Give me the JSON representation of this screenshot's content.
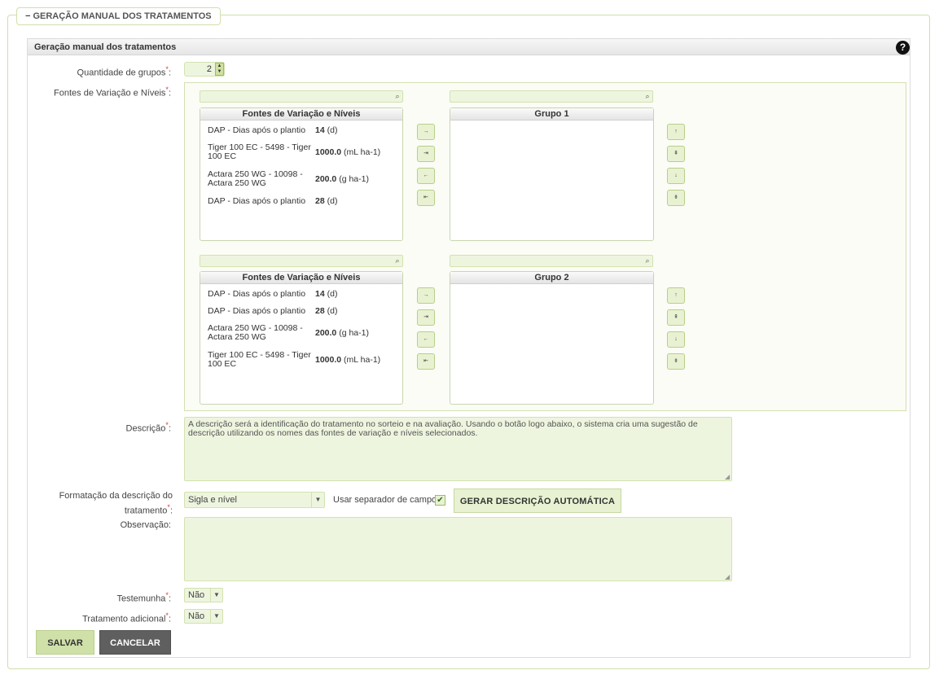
{
  "fieldset": {
    "toggle": "−",
    "legend": "GERAÇÃO MANUAL DOS TRATAMENTOS"
  },
  "panel": {
    "title": "Geração manual dos tratamentos",
    "help": "?"
  },
  "labels": {
    "quantidade": "Quantidade de grupos",
    "fontes": "Fontes de Variação e Níveis",
    "descricao": "Descrição",
    "formatacao_line1": "Formatação da descrição do",
    "formatacao_line2": "tratamento",
    "observacao": "Observação:",
    "testemunha": "Testemunha",
    "tratamento_adicional": "Tratamento adicional",
    "required_mark": "*",
    "colon": ":"
  },
  "quantidade_grupos": "2",
  "groups": [
    {
      "source_header": "Fontes de Variação e Níveis",
      "target_header": "Grupo 1",
      "items": [
        {
          "name": "DAP - Dias após o plantio",
          "value": "14",
          "unit": "(d)"
        },
        {
          "name": "Tiger 100 EC - 5498 - Tiger 100 EC",
          "value": "1000.0",
          "unit": "(mL ha-1)"
        },
        {
          "name": "Actara 250 WG - 10098 - Actara 250 WG",
          "value": "200.0",
          "unit": "(g ha-1)"
        },
        {
          "name": "DAP - Dias após o plantio",
          "value": "28",
          "unit": "(d)"
        }
      ]
    },
    {
      "source_header": "Fontes de Variação e Níveis",
      "target_header": "Grupo 2",
      "items": [
        {
          "name": "DAP - Dias após o plantio",
          "value": "14",
          "unit": "(d)"
        },
        {
          "name": "DAP - Dias após o plantio",
          "value": "28",
          "unit": "(d)"
        },
        {
          "name": "Actara 250 WG - 10098 - Actara 250 WG",
          "value": "200.0",
          "unit": "(g ha-1)"
        },
        {
          "name": "Tiger 100 EC - 5498 - Tiger 100 EC",
          "value": "1000.0",
          "unit": "(mL ha-1)"
        }
      ]
    }
  ],
  "transfer_buttons": [
    "→",
    "⇥",
    "←",
    "⇤"
  ],
  "order_buttons": [
    "↑",
    "⇞",
    "↓",
    "⇟"
  ],
  "search_icon": "⌕",
  "descricao_placeholder": "A descrição será a identificação do tratamento no sorteio e na avaliação. Usando o botão logo abaixo, o sistema cria uma sugestão de descrição utilizando os nomes das fontes de variação e níveis selecionados.",
  "formatacao_value": "Sigla e nível",
  "usar_separador_label": "Usar separador de campos",
  "usar_separador_checked": "✔",
  "gerar_button": "GERAR DESCRIÇÃO AUTOMÁTICA",
  "observacao_value": "",
  "testemunha_value": "Não",
  "tratamento_adicional_value": "Não",
  "dropdown_arrow": "▼",
  "buttons": {
    "salvar": "SALVAR",
    "cancelar": "CANCELAR"
  }
}
